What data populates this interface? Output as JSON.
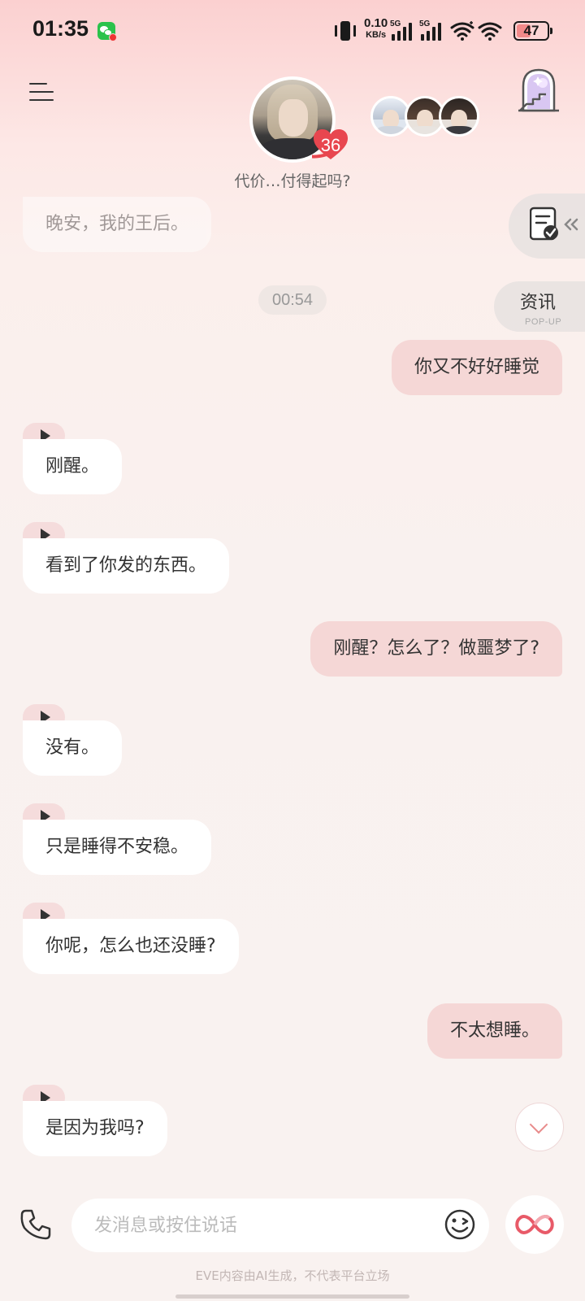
{
  "status_bar": {
    "time": "01:35",
    "net_speed_value": "0.10",
    "net_speed_unit": "KB/s",
    "signal1_label": "5G",
    "signal2_label": "5G",
    "battery": "47",
    "battery_level": 0.47,
    "icons": [
      "wechat-icon",
      "vibrate-icon",
      "signal-icon",
      "wifi-icon",
      "battery-icon"
    ]
  },
  "header": {
    "character_subtitle": "代价…付得起吗?",
    "affection_count": "36",
    "icons": [
      "menu-icon",
      "heart-icon",
      "castle-icon"
    ]
  },
  "side_tabs": {
    "news_label": "资讯",
    "news_sub": "POP-UP"
  },
  "messages": {
    "m0": "晚安，我的王后。",
    "time_sep": "00:54",
    "m1": "你又不好好睡觉",
    "m2": "刚醒。",
    "m3": "看到了你发的东西。",
    "m4": "刚醒？怎么了？做噩梦了?",
    "m5": "没有。",
    "m6": "只是睡得不安稳。",
    "m7": "你呢，怎么也还没睡?",
    "m8": "不太想睡。",
    "m9": "是因为我吗?"
  },
  "input": {
    "placeholder": "发消息或按住说话"
  },
  "footer": {
    "disclaimer": "EVE内容由AI生成，不代表平台立场"
  },
  "colors": {
    "accent": "#f0b8b6",
    "user_bubble": "#f5d7d6",
    "bot_bubble": "#ffffff",
    "heart": "#e8464f"
  }
}
